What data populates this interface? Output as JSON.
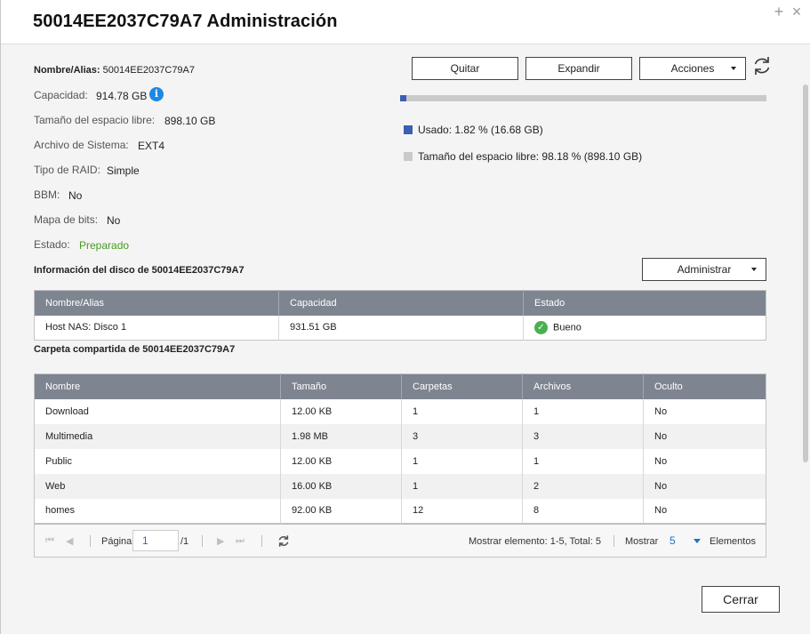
{
  "window": {
    "title": "50014EE2037C79A7  Administración",
    "add_glyph": "+",
    "close_glyph": "×"
  },
  "info": {
    "name_label": "Nombre/Alias:",
    "name_value": "50014EE2037C79A7",
    "capacity_label": "Capacidad:",
    "capacity_value": "914.78 GB",
    "free_label": "Tamaño del espacio libre:",
    "free_value": "898.10 GB",
    "fs_label": "Archivo de Sistema:",
    "fs_value": "EXT4",
    "raid_label": "Tipo de RAID:",
    "raid_value": "Simple",
    "bbm_label": "BBM:",
    "bbm_value": "No",
    "bitmap_label": "Mapa de bits:",
    "bitmap_value": "No",
    "status_label": "Estado:",
    "status_value": "Preparado",
    "status_color": "#4a9b23",
    "info_icon": "i"
  },
  "actions": {
    "remove": "Quitar",
    "expand": "Expandir",
    "actions": "Acciones"
  },
  "usage": {
    "used_fraction": 0.0182,
    "used_color": "#3c5fb3",
    "free_color": "#cacaca",
    "used_legend": "Usado: 1.82 % (16.68 GB)",
    "free_legend": "Tamaño del espacio libre: 98.18 % (898.10 GB)"
  },
  "disk_section": {
    "title": "Información del disco de 50014EE2037C79A7",
    "manage_button": "Administrar",
    "columns": [
      "Nombre/Alias",
      "Capacidad",
      "Estado"
    ],
    "rows": [
      {
        "name": "Host NAS: Disco 1",
        "capacity": "931.51 GB",
        "status": "Bueno",
        "status_icon": "check-circle-icon"
      }
    ]
  },
  "share_section": {
    "title": "Carpeta compartida de 50014EE2037C79A7",
    "columns": [
      "Nombre",
      "Tamaño",
      "Carpetas",
      "Archivos",
      "Oculto"
    ],
    "rows": [
      {
        "name": "Download",
        "size": "12.00 KB",
        "folders": "1",
        "files": "1",
        "hidden": "No"
      },
      {
        "name": "Multimedia",
        "size": "1.98 MB",
        "folders": "3",
        "files": "3",
        "hidden": "No"
      },
      {
        "name": "Public",
        "size": "12.00 KB",
        "folders": "1",
        "files": "1",
        "hidden": "No"
      },
      {
        "name": "Web",
        "size": "16.00 KB",
        "folders": "1",
        "files": "2",
        "hidden": "No"
      },
      {
        "name": "homes",
        "size": "92.00 KB",
        "folders": "12",
        "files": "8",
        "hidden": "No"
      }
    ]
  },
  "pager": {
    "page_label": "Página",
    "page_value": "1",
    "page_total": "/1",
    "summary": "Mostrar elemento: 1-5, Total: 5",
    "show_label": "Mostrar",
    "per_page": "5",
    "items_label": "Elementos"
  },
  "footer": {
    "close": "Cerrar"
  }
}
